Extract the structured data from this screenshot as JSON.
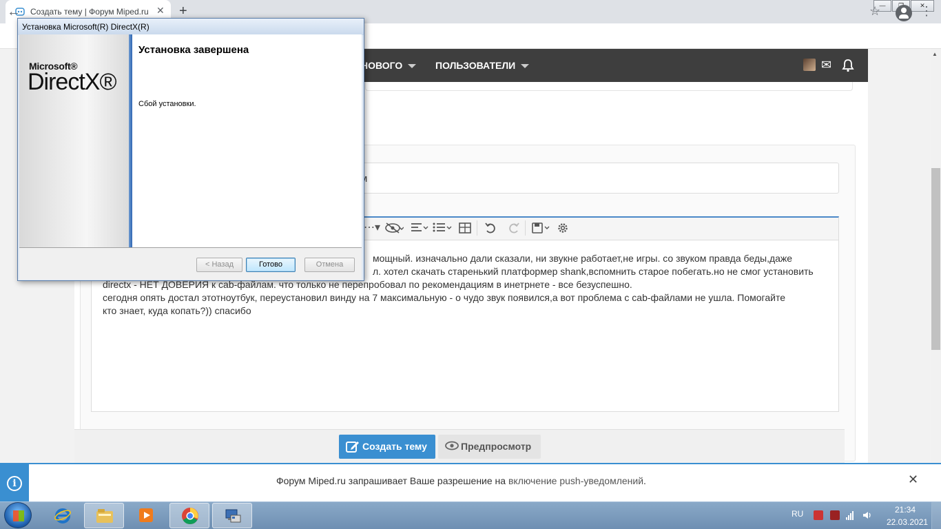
{
  "browser": {
    "tab_title": "Создать тему | Форум Miped.ru",
    "tab_close": "✕",
    "new_tab": "+",
    "back": "←",
    "bookmark_star": "☆",
    "menu": "⋮"
  },
  "window_controls": {
    "minimize": "—",
    "restore": "❐",
    "close": "✕"
  },
  "nav": {
    "items": [
      {
        "label": "НОВОГО"
      },
      {
        "label": "ПОЛЬЗОВАТЕЛИ"
      }
    ],
    "mail_icon": "✉",
    "bell_icon": "🔔"
  },
  "form": {
    "title_value": "м",
    "editor_lines": [
      "мощный. изначально дали сказали, ни звукне работает,не игры. со звуком правда беды,даже",
      "л. хотел скачать старенький платформер shank,вспомнить старое побегать.но не смог установить",
      "directx - НЕТ ДОВЕРИЯ к cab-файлам. что только не перепробовал по рекомендациям в инетрнете - все безуспешно.",
      "сегодня опять достал этотноутбук, переустановил винду на 7 максимальную - о чудо звук появился,а вот проблема с cab-файлами не ушла. Помогайте",
      "кто знает, куда копать?)) спасибо"
    ],
    "submit_label": "Создать тему",
    "preview_label": "Предпросмотр"
  },
  "notification": {
    "text_before": "Форум Miped.ru запрашивает Ваше разрешение на ",
    "link_text": "включение push-уведомлений",
    "text_after": ".",
    "info_icon": "i",
    "close": "✕"
  },
  "dialog": {
    "title": "Установка Microsoft(R) DirectX(R)",
    "logo_small": "Microsoft®",
    "logo_big": "DirectX®",
    "heading": "Установка завершена",
    "message": "Сбой установки.",
    "back_label": "< Назад",
    "finish_label": "Готово",
    "cancel_label": "Отмена"
  },
  "taskbar": {
    "language": "RU",
    "time": "21:34",
    "date": "22.03.2021"
  },
  "colors": {
    "accent": "#3a8fd1",
    "nav_bg": "#3e3e3e",
    "taskbar": "#7a9abc"
  }
}
